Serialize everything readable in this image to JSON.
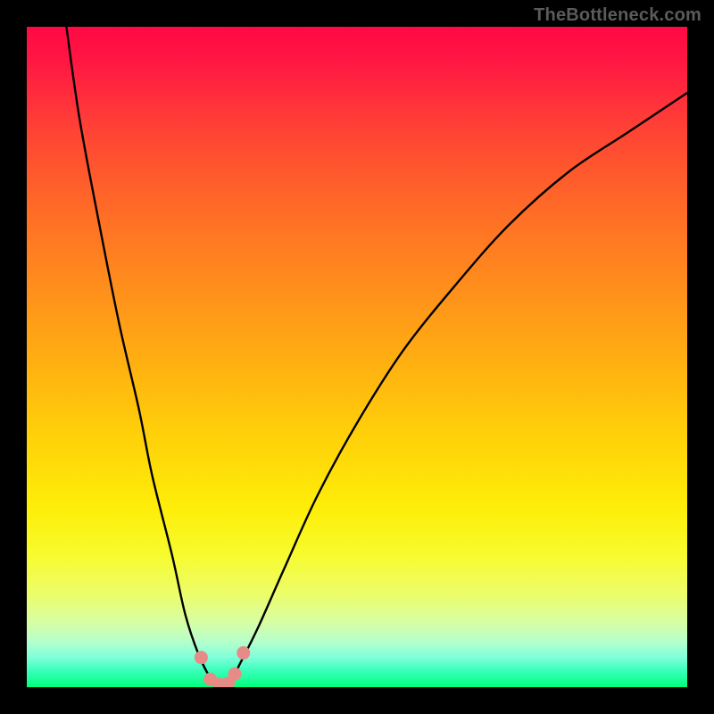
{
  "watermark": "TheBottleneck.com",
  "chart_data": {
    "type": "line",
    "title": "",
    "xlabel": "",
    "ylabel": "",
    "xlim": [
      0,
      100
    ],
    "ylim": [
      0,
      100
    ],
    "series": [
      {
        "name": "bottleneck-curve",
        "x": [
          6,
          8,
          11,
          14,
          17,
          19,
          22,
          24,
          26,
          28,
          29,
          30,
          31,
          32,
          35,
          39,
          44,
          50,
          57,
          65,
          73,
          82,
          91,
          100
        ],
        "y": [
          100,
          86,
          70,
          55,
          42,
          32,
          20,
          11,
          5,
          1,
          0,
          0,
          1,
          3,
          9,
          18,
          29,
          40,
          51,
          61,
          70,
          78,
          84,
          90
        ]
      }
    ],
    "markers": {
      "name": "highlight-points",
      "x": [
        26.4,
        27.8,
        29.2,
        30.5,
        31.5,
        32.8
      ],
      "y": [
        4.5,
        1.2,
        0.4,
        0.6,
        2.0,
        5.2
      ]
    },
    "gradient_bands": [
      {
        "pos": 0.0,
        "color": "#ff0945"
      },
      {
        "pos": 0.5,
        "color": "#ffad12"
      },
      {
        "pos": 0.8,
        "color": "#f7fb2e"
      },
      {
        "pos": 1.0,
        "color": "#00ff7c"
      }
    ]
  }
}
